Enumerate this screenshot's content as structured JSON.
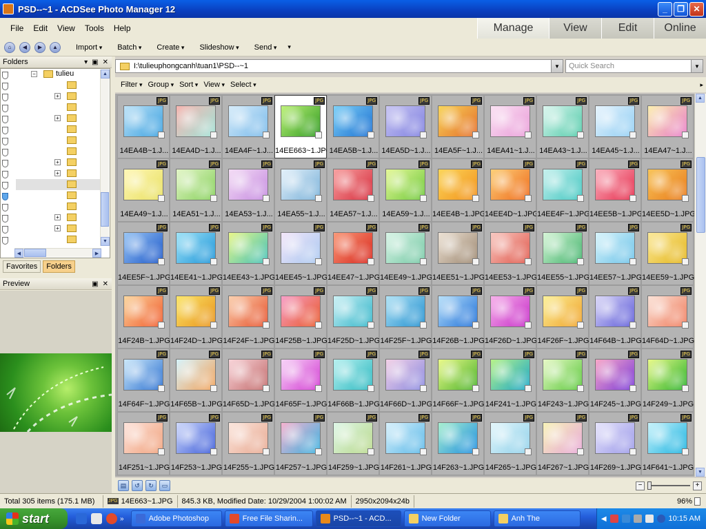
{
  "window": {
    "title": "PSD--~1 - ACDSee Photo Manager 12"
  },
  "menu": [
    "File",
    "Edit",
    "View",
    "Tools",
    "Help"
  ],
  "modes": [
    {
      "label": "Manage",
      "active": true
    },
    {
      "label": "View",
      "active": false
    },
    {
      "label": "Edit",
      "active": false
    },
    {
      "label": "Online",
      "active": false
    }
  ],
  "toolbar": [
    "Import",
    "Batch",
    "Create",
    "Slideshow",
    "Send"
  ],
  "folders_panel": {
    "title": "Folders",
    "tree_root": "tulieu",
    "tabs": [
      "Favorites",
      "Folders"
    ],
    "active_tab": "Folders"
  },
  "preview_panel": {
    "title": "Preview"
  },
  "path": "I:\\tulieuphongcanh\\tuan1\\PSD--~1",
  "quick_search_placeholder": "Quick Search",
  "filter_bar": [
    "Filter",
    "Group",
    "Sort",
    "View",
    "Select"
  ],
  "file_type_badge": "JPG",
  "selected_index": 3,
  "thumbnails": [
    {
      "name": "14EA4B~1.J...",
      "colors": [
        "#bfe3f7",
        "#3aa0e0"
      ]
    },
    {
      "name": "14EA4D~1.J...",
      "colors": [
        "#f7b5b0",
        "#9fe2d6"
      ]
    },
    {
      "name": "14EA4F~1.J...",
      "colors": [
        "#d7ecfa",
        "#78b9ea"
      ]
    },
    {
      "name": "14EE663~1.JPG",
      "colors": [
        "#bff27a",
        "#2e9a20"
      ]
    },
    {
      "name": "14EA5B~1.J...",
      "colors": [
        "#7fd1f7",
        "#1b6fd1"
      ]
    },
    {
      "name": "14EA5D~1.J...",
      "colors": [
        "#c9c6f2",
        "#7e7fe0"
      ]
    },
    {
      "name": "14EA5F~1.J...",
      "colors": [
        "#f8d55a",
        "#e46d2a"
      ]
    },
    {
      "name": "14EA41~1.J...",
      "colors": [
        "#fbe2f3",
        "#e99bd8"
      ]
    },
    {
      "name": "14EA43~1.J...",
      "colors": [
        "#ddf6ef",
        "#4fcaa8"
      ]
    },
    {
      "name": "14EA45~1.J...",
      "colors": [
        "#e7f4fd",
        "#8fcdf3"
      ]
    },
    {
      "name": "14EA47~1.J...",
      "colors": [
        "#fbf0b0",
        "#e87ac8"
      ]
    },
    {
      "name": "14EA49~1.J...",
      "colors": [
        "#fff7b8",
        "#e8e060"
      ]
    },
    {
      "name": "14EA51~1.J...",
      "colors": [
        "#e3f5c8",
        "#86d05a"
      ]
    },
    {
      "name": "14EA53~1.J...",
      "colors": [
        "#f4ddf5",
        "#c58ae0"
      ]
    },
    {
      "name": "14EA55~1.J...",
      "colors": [
        "#e4f1fa",
        "#78b0d8"
      ]
    },
    {
      "name": "14EA57~1.J...",
      "colors": [
        "#f7a2a2",
        "#d62a3a"
      ]
    },
    {
      "name": "14EA59~1.J...",
      "colors": [
        "#e6f89a",
        "#6ec83a"
      ]
    },
    {
      "name": "14EE4B~1.JPG",
      "colors": [
        "#fbd55a",
        "#f2921c"
      ]
    },
    {
      "name": "14EE4D~1.JPG",
      "colors": [
        "#fcd07a",
        "#ef6a1a"
      ]
    },
    {
      "name": "14EE4F~1.JPG",
      "colors": [
        "#c8f1ee",
        "#3fc6c0"
      ]
    },
    {
      "name": "14EE5B~1.JPG",
      "colors": [
        "#fbb3c0",
        "#e52a4a"
      ]
    },
    {
      "name": "14EE5D~1.JPG",
      "colors": [
        "#f8c45a",
        "#e87a1a"
      ]
    },
    {
      "name": "14EE5F~1.JPG",
      "colors": [
        "#9ac6f5",
        "#1a56c8"
      ]
    },
    {
      "name": "14EE41~1.JPG",
      "colors": [
        "#9fe3f7",
        "#1c94d8"
      ]
    },
    {
      "name": "14EE43~1.JPG",
      "colors": [
        "#e9f78a",
        "#42c0b8"
      ]
    },
    {
      "name": "14EE45~1.JPG",
      "colors": [
        "#f3e6f9",
        "#a9c8f0"
      ]
    },
    {
      "name": "14EE47~1.JPG",
      "colors": [
        "#f99a7a",
        "#d8261c"
      ]
    },
    {
      "name": "14EE49~1.JPG",
      "colors": [
        "#d9f4e6",
        "#74c8a4"
      ]
    },
    {
      "name": "14EE51~1.JPG",
      "colors": [
        "#ece1d4",
        "#9c8770"
      ]
    },
    {
      "name": "14EE53~1.JPG",
      "colors": [
        "#f8c9c2",
        "#e0574a"
      ]
    },
    {
      "name": "14EE55~1.JPG",
      "colors": [
        "#d8f6d8",
        "#3fb26a"
      ]
    },
    {
      "name": "14EE57~1.JPG",
      "colors": [
        "#d8f4fb",
        "#6cc2e8"
      ]
    },
    {
      "name": "14EE59~1.JPG",
      "colors": [
        "#fbe99a",
        "#e4b51a"
      ]
    },
    {
      "name": "14F24B~1.JPG",
      "colors": [
        "#fbd7a0",
        "#f0592a"
      ]
    },
    {
      "name": "14F24D~1.JPG",
      "colors": [
        "#fbe66a",
        "#e8921a"
      ]
    },
    {
      "name": "14F24F~1.JPG",
      "colors": [
        "#fbd1b0",
        "#e6502a"
      ]
    },
    {
      "name": "14F25B~1.JPG",
      "colors": [
        "#f7a0c8",
        "#e8582a"
      ]
    },
    {
      "name": "14F25D~1.JPG",
      "colors": [
        "#cdf1f5",
        "#2fb4c8"
      ]
    },
    {
      "name": "14F25F~1.JPG",
      "colors": [
        "#b2e3f5",
        "#1e8ecf"
      ]
    },
    {
      "name": "14F26B~1.JPG",
      "colors": [
        "#b9e1fa",
        "#1e6fd8"
      ]
    },
    {
      "name": "14F26D~1.JPG",
      "colors": [
        "#f7b3ea",
        "#c62ac8"
      ]
    },
    {
      "name": "14F26F~1.JPG",
      "colors": [
        "#fbf19a",
        "#f0a22a"
      ]
    },
    {
      "name": "14F64B~1.JPG",
      "colors": [
        "#dcd9f7",
        "#5a58d8"
      ]
    },
    {
      "name": "14F64D~1.JPG",
      "colors": [
        "#fbe3d8",
        "#ef7a5a"
      ]
    },
    {
      "name": "14F64F~1.JPG",
      "colors": [
        "#cde9fa",
        "#2a6fd0"
      ]
    },
    {
      "name": "14F65B~1.JPG",
      "colors": [
        "#d6f3fb",
        "#f2a25a"
      ]
    },
    {
      "name": "14F65D~1.JPG",
      "colors": [
        "#f8d4d9",
        "#c26a6a"
      ]
    },
    {
      "name": "14F65F~1.JPG",
      "colors": [
        "#f7d4f7",
        "#d23ad2"
      ]
    },
    {
      "name": "14F66B~1.JPG",
      "colors": [
        "#b9f1f0",
        "#2ab8c0"
      ]
    },
    {
      "name": "14F66D~1.JPG",
      "colors": [
        "#f3d1e6",
        "#8a8ae0"
      ]
    },
    {
      "name": "14F66F~1.JPG",
      "colors": [
        "#eaf98a",
        "#4ab22a"
      ]
    },
    {
      "name": "14F241~1.JPG",
      "colors": [
        "#b8f38a",
        "#1aa6c8"
      ]
    },
    {
      "name": "14F243~1.JPG",
      "colors": [
        "#e8f9c8",
        "#5ac83a"
      ]
    },
    {
      "name": "14F245~1.JPG",
      "colors": [
        "#f9a8c8",
        "#7a3ad8"
      ]
    },
    {
      "name": "14F249~1.JPG",
      "colors": [
        "#e9f98a",
        "#2ab22a"
      ]
    },
    {
      "name": "14F251~1.JPG",
      "colors": [
        "#fde4dc",
        "#f0a07a"
      ]
    },
    {
      "name": "14F253~1.JPG",
      "colors": [
        "#cfd9fb",
        "#3a5ad8"
      ]
    },
    {
      "name": "14F255~1.JPG",
      "colors": [
        "#fbe6dd",
        "#e8a890"
      ]
    },
    {
      "name": "14F257~1.JPG",
      "colors": [
        "#f7b3d0",
        "#3ab2e0"
      ]
    },
    {
      "name": "14F259~1.JPG",
      "colors": [
        "#dff7e8",
        "#b8d88a"
      ]
    },
    {
      "name": "14F261~1.JPG",
      "colors": [
        "#d7f0fb",
        "#5ab8e8"
      ]
    },
    {
      "name": "14F263~1.JPG",
      "colors": [
        "#a8f0d0",
        "#1e8ee0"
      ]
    },
    {
      "name": "14F265~1.JPG",
      "colors": [
        "#e4f7fb",
        "#8fd0ea"
      ]
    },
    {
      "name": "14F267~1.JPG",
      "colors": [
        "#f7f3b8",
        "#e8a8d8"
      ]
    },
    {
      "name": "14F269~1.JPG",
      "colors": [
        "#e6e4fb",
        "#9a98e8"
      ]
    },
    {
      "name": "14F641~1.JPG",
      "colors": [
        "#c8f3fb",
        "#1ab2e0"
      ]
    }
  ],
  "status": {
    "total": "Total 305 items  (175.1 MB)",
    "selected_file": "14E663~1.JPG",
    "info": "845.3 KB, Modified Date: 10/29/2004 1:00:02 AM",
    "dimensions": "2950x2094x24b",
    "zoom_percent": "96%"
  },
  "taskbar": {
    "start": "start",
    "tasks": [
      {
        "label": "Adobe Photoshop",
        "color": "#3a6ad8",
        "active": false
      },
      {
        "label": "Free File Sharin...",
        "color": "#e24a2a",
        "active": false
      },
      {
        "label": "PSD--~1 - ACD...",
        "color": "#e8891a",
        "active": true
      },
      {
        "label": "New Folder",
        "color": "#f4d063",
        "active": false
      },
      {
        "label": "Anh The",
        "color": "#f4d063",
        "active": false
      }
    ],
    "clock": "10:15 AM"
  }
}
